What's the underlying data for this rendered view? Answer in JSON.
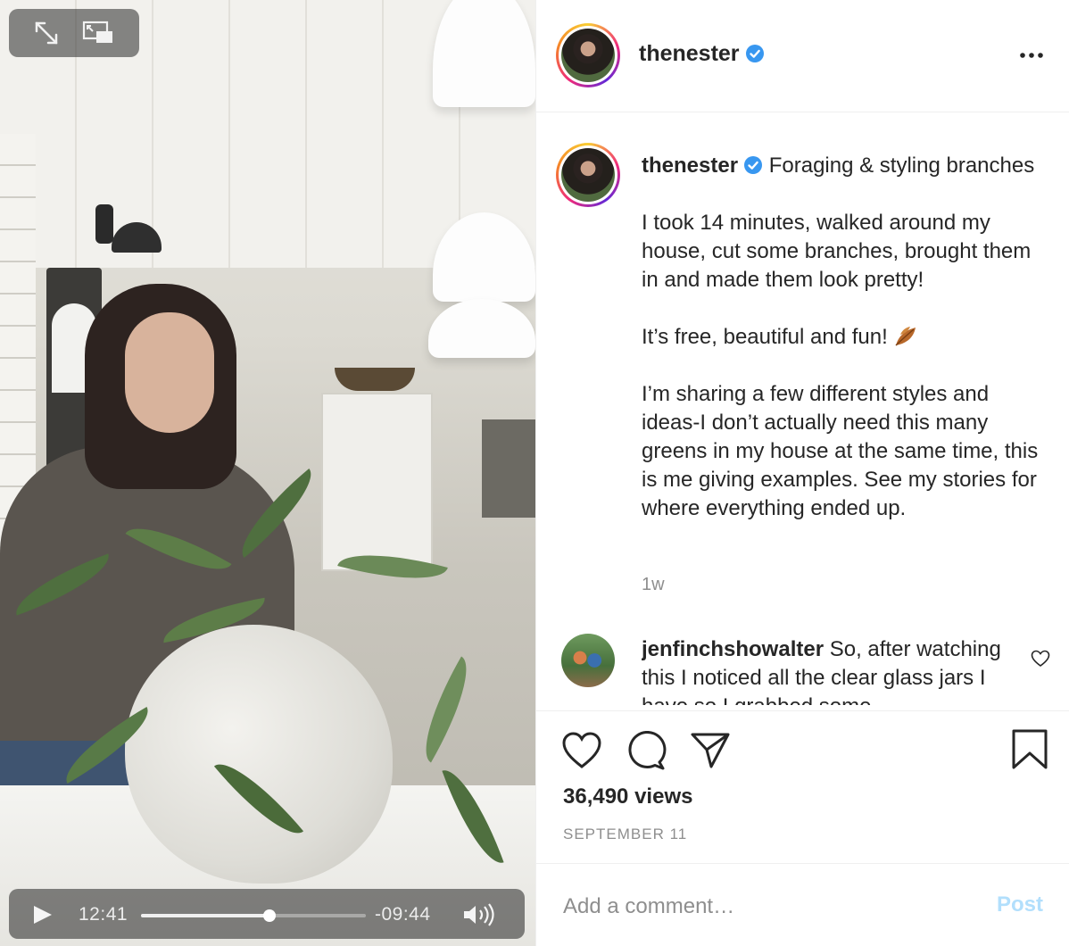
{
  "video": {
    "elapsed": "12:41",
    "remaining": "-09:44",
    "progress_fraction": 0.57
  },
  "header": {
    "username": "thenester"
  },
  "caption": {
    "username": "thenester",
    "title": "Foraging & styling branches",
    "paragraphs": [
      "I took 14 minutes, walked around my house, cut some branches, brought them in and made them look pretty!",
      "It’s free, beautiful and fun!",
      "I’m sharing a few different styles and ideas-I don’t actually need this many greens in my house at the same time, this is me giving examples. See my stories for where everything ended up."
    ],
    "timestamp": "1w"
  },
  "comment": {
    "username": "jenfinchshowalter",
    "text": "So, after watching this I noticed all the clear glass jars I have so I grabbed some"
  },
  "stats": {
    "views": "36,490 views",
    "date": "SEPTEMBER 11"
  },
  "comment_box": {
    "placeholder": "Add a comment…",
    "post_label": "Post"
  },
  "colors": {
    "verified": "#3897f0",
    "post_button_disabled": "#b2dffc",
    "secondary_text": "#8e8e8e",
    "primary_text": "#262626"
  },
  "icons": [
    "expand-icon",
    "picture-in-picture-icon",
    "play-icon",
    "volume-icon",
    "more-options-icon",
    "verified-badge-icon",
    "heart-icon",
    "comment-icon",
    "share-icon",
    "bookmark-icon"
  ]
}
